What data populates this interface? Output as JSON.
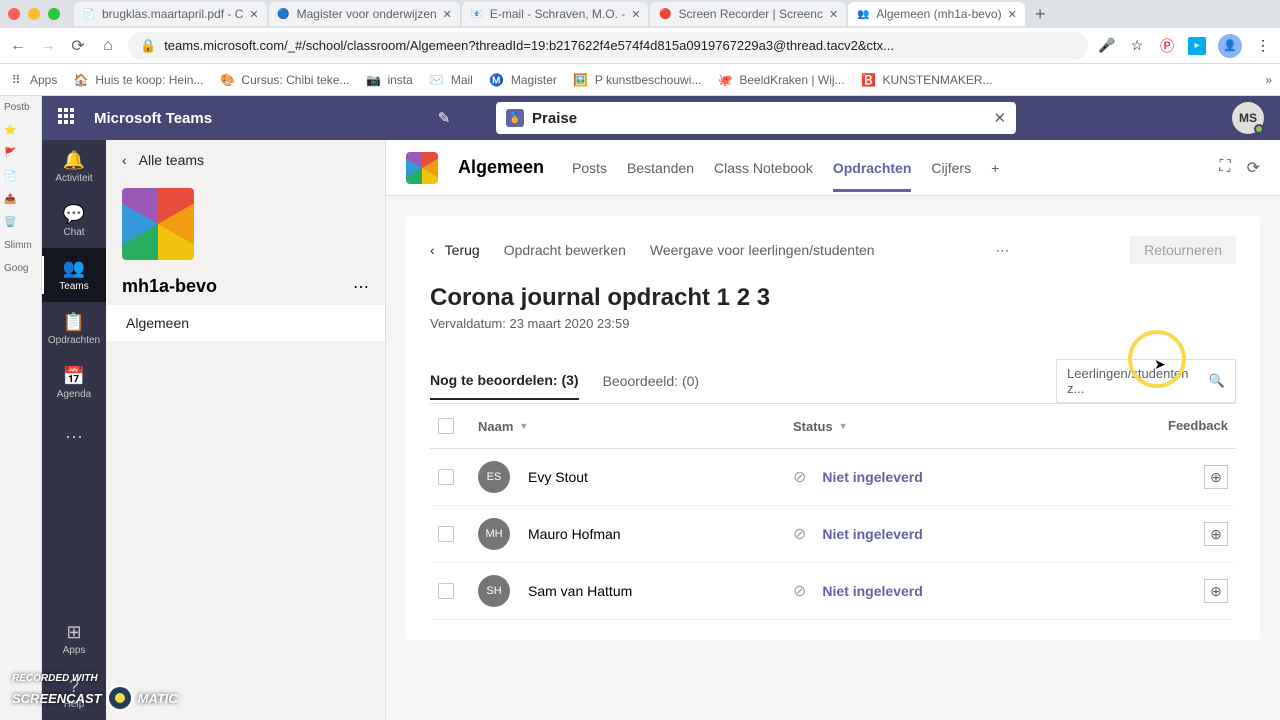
{
  "browser": {
    "tabs": [
      {
        "favicon": "📄",
        "title": "brugklas.maartapril.pdf - C"
      },
      {
        "favicon": "🔵",
        "title": "Magister voor onderwijzen"
      },
      {
        "favicon": "📧",
        "title": "E-mail - Schraven, M.O. -"
      },
      {
        "favicon": "🔴",
        "title": "Screen Recorder | Screenc"
      },
      {
        "favicon": "👥",
        "title": "Algemeen (mh1a-bevo)"
      }
    ],
    "url": "teams.microsoft.com/_#/school/classroom/Algemeen?threadId=19:b217622f4e574f4d815a0919767229a3@thread.tacv2&ctx...",
    "bookmarks": [
      {
        "icon": "⠿",
        "label": "Apps"
      },
      {
        "icon": "🏠",
        "label": "Huis te koop: Hein..."
      },
      {
        "icon": "🎨",
        "label": "Cursus: Chibi teke..."
      },
      {
        "icon": "📷",
        "label": "insta"
      },
      {
        "icon": "✉️",
        "label": "Mail"
      },
      {
        "icon": "Ⓜ️",
        "label": "Magister"
      },
      {
        "icon": "🖼️",
        "label": "P kunstbeschouwi..."
      },
      {
        "icon": "🐙",
        "label": "BeeldKraken | Wij..."
      },
      {
        "icon": "🅱️",
        "label": "KUNSTENMAKER..."
      }
    ]
  },
  "os_sidebar": [
    "Postb",
    "Slimm",
    "Goog"
  ],
  "teams": {
    "app_title": "Microsoft Teams",
    "praise_label": "Praise",
    "user_initials": "MS",
    "rail": [
      {
        "icon": "🔔",
        "label": "Activiteit"
      },
      {
        "icon": "💬",
        "label": "Chat"
      },
      {
        "icon": "👥",
        "label": "Teams",
        "active": true
      },
      {
        "icon": "📋",
        "label": "Opdrachten"
      },
      {
        "icon": "📅",
        "label": "Agenda"
      }
    ],
    "rail_bottom": [
      {
        "icon": "⊞",
        "label": "Apps"
      },
      {
        "icon": "?",
        "label": "Help"
      }
    ],
    "back_all": "Alle teams",
    "team_name": "mh1a-bevo",
    "channel": "Algemeen",
    "channel_tabs": [
      "Posts",
      "Bestanden",
      "Class Notebook",
      "Opdrachten",
      "Cijfers"
    ],
    "active_tab": "Opdrachten",
    "toolbar": {
      "back": "Terug",
      "edit": "Opdracht bewerken",
      "student_view": "Weergave voor leerlingen/studenten",
      "return_btn": "Retourneren"
    },
    "assignment": {
      "title": "Corona journal opdracht 1 2 3",
      "due": "Vervaldatum: 23 maart 2020 23:59"
    },
    "filter": {
      "to_grade": "Nog te beoordelen: (3)",
      "graded": "Beoordeeld: (0)",
      "search_placeholder": "Leerlingen/studenten z..."
    },
    "columns": {
      "name": "Naam",
      "status": "Status",
      "feedback": "Feedback"
    },
    "students": [
      {
        "initials": "ES",
        "name": "Evy Stout",
        "status": "Niet ingeleverd"
      },
      {
        "initials": "MH",
        "name": "Mauro Hofman",
        "status": "Niet ingeleverd"
      },
      {
        "initials": "SH",
        "name": "Sam van Hattum",
        "status": "Niet ingeleverd"
      }
    ]
  },
  "watermark": {
    "line1": "RECORDED WITH",
    "line2a": "SCREENCAST",
    "line2b": "MATIC"
  }
}
